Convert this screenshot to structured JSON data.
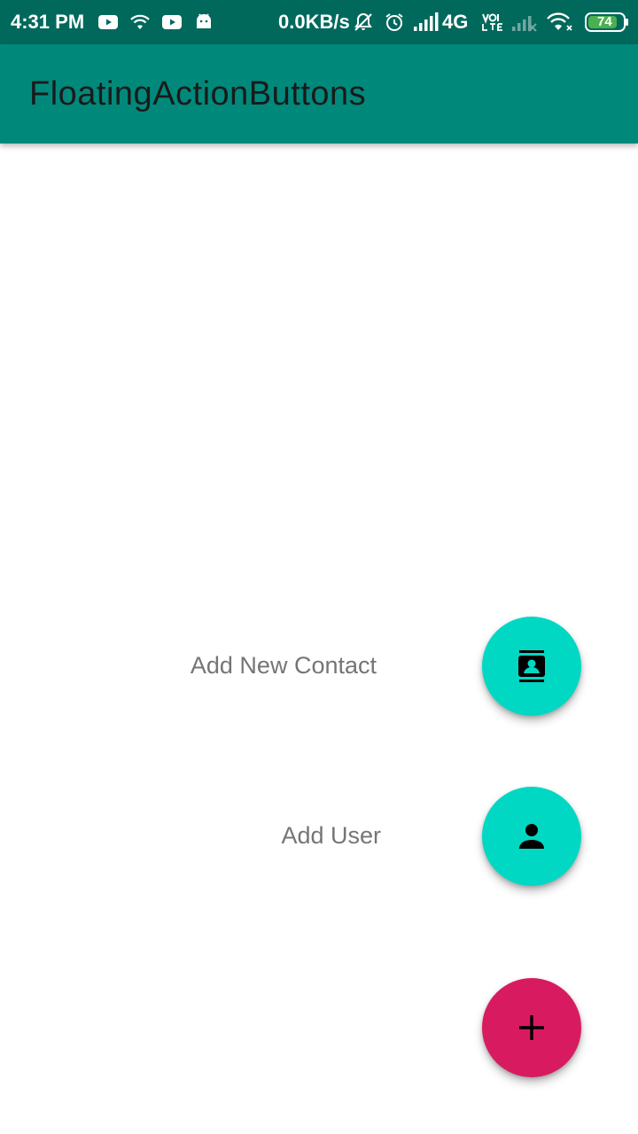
{
  "status_bar": {
    "time": "4:31 PM",
    "network_speed": "0.0KB/s",
    "network_type": "4G",
    "battery_level": "74",
    "battery_color": "#4caf50",
    "icons": [
      "youtube-icon",
      "wifi-icon",
      "youtube-icon",
      "android-icon",
      "notifications-off-icon",
      "alarm-icon",
      "signal-icon",
      "volte-icon",
      "signal-weak-icon",
      "wifi-icon",
      "battery-icon"
    ]
  },
  "app_bar": {
    "title": "FloatingActionButtons",
    "background": "#00897b"
  },
  "fabs": {
    "add_contact": {
      "label": "Add New Contact",
      "icon": "contacts-icon",
      "color": "#00d8c4"
    },
    "add_user": {
      "label": "Add User",
      "icon": "person-icon",
      "color": "#00d8c4"
    },
    "main": {
      "icon": "plus-icon",
      "color": "#d81b60"
    }
  }
}
